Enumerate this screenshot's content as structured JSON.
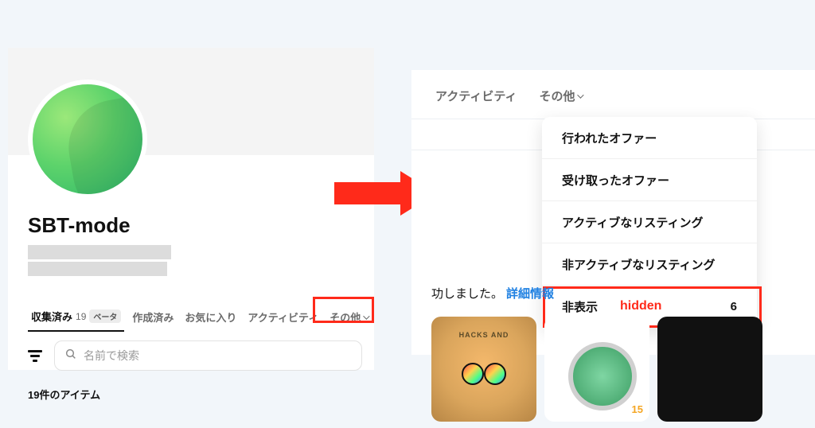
{
  "left": {
    "username": "SBT-mode",
    "tabs": {
      "collected": {
        "label": "収集済み",
        "count": "19",
        "badge": "ベータ"
      },
      "created": {
        "label": "作成済み"
      },
      "favorite": {
        "label": "お気に入り"
      },
      "activity": {
        "label": "アクティビティ"
      },
      "more": {
        "label": "その他"
      }
    },
    "search_placeholder": "名前で検索",
    "item_count": "19件のアイテム"
  },
  "right": {
    "tabs": {
      "activity": "アクティビティ",
      "more": "その他"
    },
    "dropdown": {
      "offers_made": "行われたオファー",
      "offers_received": "受け取ったオファー",
      "active_listings": "アクティブなリスティング",
      "inactive_listings": "非アクティブなリスティング",
      "hidden": "非表示",
      "hidden_annotation": "hidden",
      "hidden_count": "6"
    },
    "success": {
      "text": "功しました。",
      "link": "詳細情報"
    },
    "thumb2_number": "15"
  }
}
